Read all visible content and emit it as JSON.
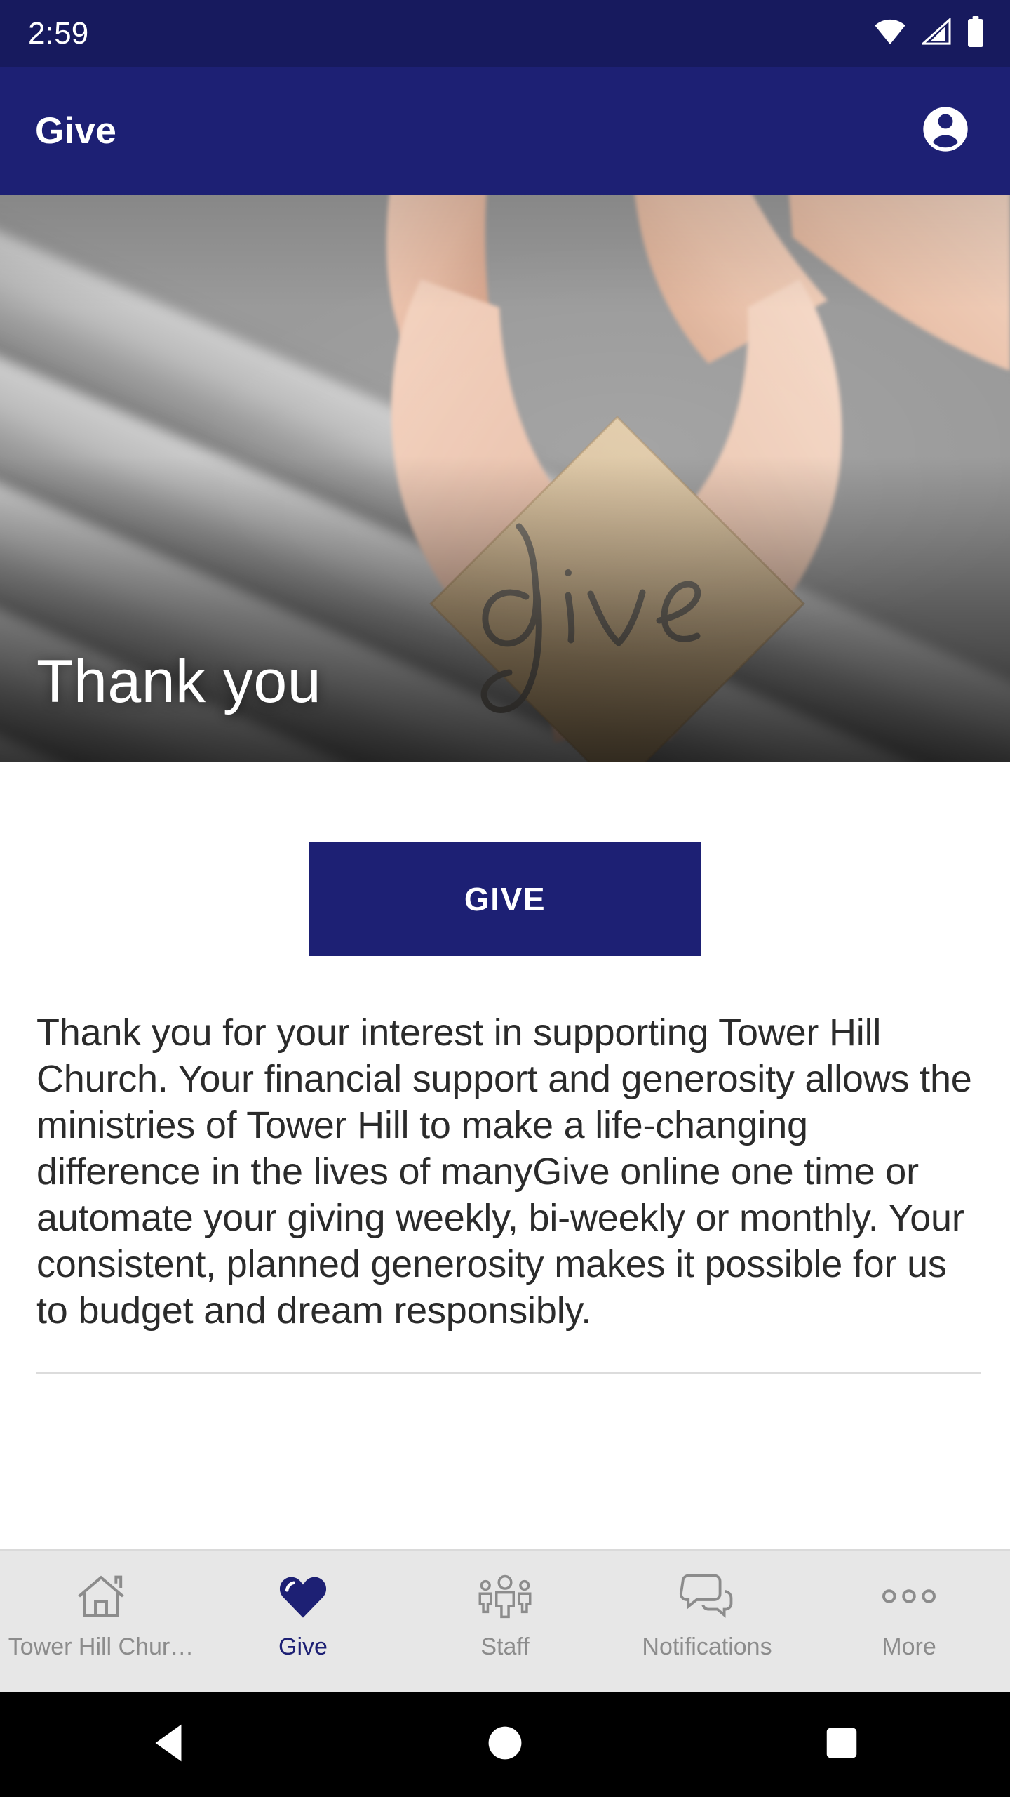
{
  "statusbar": {
    "time": "2:59",
    "icons": [
      "wifi-icon",
      "cell-signal-icon",
      "battery-icon"
    ],
    "background": "#171a5e"
  },
  "appbar": {
    "title": "Give",
    "account_icon": "account-circle-icon",
    "background": "#1d2074",
    "text_color": "#ffffff"
  },
  "hero": {
    "overlay_title": "Thank you",
    "image_alt": "give-hands-photo",
    "card_word": "give"
  },
  "main": {
    "give_button_label": "GIVE",
    "give_button_color": "#1d2074",
    "body_text": "Thank you for your interest in supporting Tower Hill Church. Your financial support and generosity allows the ministries of Tower Hill to make a life-changing difference in the lives of manyGive online one time or automate your giving weekly, bi-weekly or monthly. Your consistent, planned generosity makes it possible for us to budget and dream responsibly."
  },
  "bottomnav": {
    "background": "#e7e7e7",
    "active_color": "#1d2074",
    "inactive_color": "#8c8c8c",
    "items": [
      {
        "label": "Tower Hill Chur…",
        "icon": "home-icon",
        "active": false
      },
      {
        "label": "Give",
        "icon": "heart-icon",
        "active": true
      },
      {
        "label": "Staff",
        "icon": "people-group-icon",
        "active": false
      },
      {
        "label": "Notifications",
        "icon": "chat-bubbles-icon",
        "active": false
      },
      {
        "label": "More",
        "icon": "more-dots-icon",
        "active": false
      }
    ]
  },
  "sysnav": {
    "background": "#000000",
    "buttons": [
      {
        "name": "back-button",
        "icon": "back-triangle-icon"
      },
      {
        "name": "home-button",
        "icon": "home-circle-icon"
      },
      {
        "name": "recents-button",
        "icon": "recents-square-icon"
      }
    ]
  }
}
